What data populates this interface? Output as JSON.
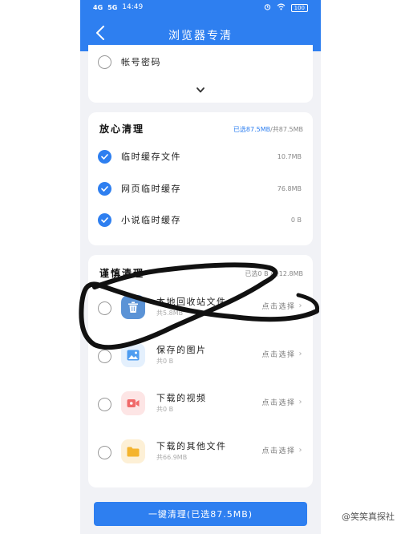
{
  "status": {
    "signal1": "4G",
    "signal2": "5G",
    "time": "14:49",
    "battery": "100"
  },
  "nav": {
    "title": "浏览器专清"
  },
  "top_card": {
    "item_label": "帐号密码"
  },
  "safe_section": {
    "title": "放心清理",
    "selected": "已选87.5MB",
    "total": "/共87.5MB",
    "items": [
      {
        "label": "临时缓存文件",
        "size": "10.7MB",
        "checked": true
      },
      {
        "label": "网页临时缓存",
        "size": "76.8MB",
        "checked": true
      },
      {
        "label": "小说临时缓存",
        "size": "0 B",
        "checked": true
      }
    ]
  },
  "careful_section": {
    "title": "谨慎清理",
    "meta": "已选0 B /共12.8MB",
    "items": [
      {
        "title": "本地回收站文件",
        "sub": "共5.8MB",
        "action": "点击选择",
        "icon": "trash-icon",
        "color": "#5b93d6"
      },
      {
        "title": "保存的图片",
        "sub": "共0 B",
        "action": "点击选择",
        "icon": "image-icon",
        "color": "#4d9cf0"
      },
      {
        "title": "下载的视频",
        "sub": "共0 B",
        "action": "点击选择",
        "icon": "video-icon",
        "color": "#f06a6a"
      },
      {
        "title": "下载的其他文件",
        "sub": "共66.9MB",
        "action": "点击选择",
        "icon": "folder-icon",
        "color": "#f4b42e"
      }
    ]
  },
  "footer": {
    "button": "一键清理(已选87.5MB)",
    "watermark": "@笑笑真探社"
  },
  "colors": {
    "accent": "#2e7ff0",
    "background": "#f1f2f6"
  }
}
